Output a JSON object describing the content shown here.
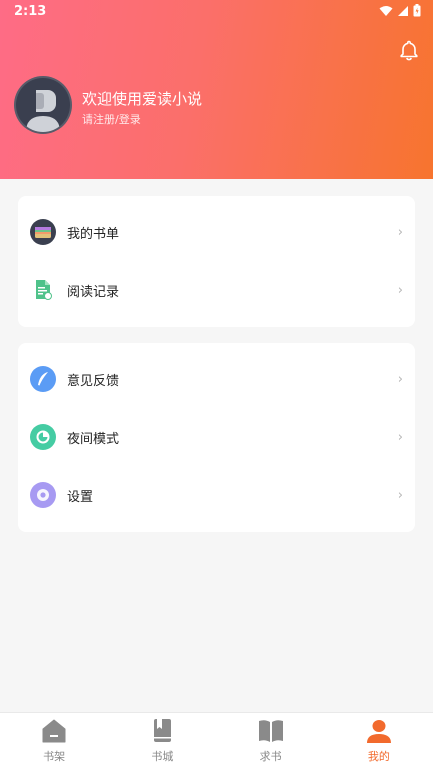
{
  "status": {
    "time": "2:13"
  },
  "profile": {
    "welcome": "欢迎使用爱读小说",
    "login": "请注册/登录"
  },
  "menu_group_1": [
    {
      "label": "我的书单",
      "icon": "booklist-icon"
    },
    {
      "label": "阅读记录",
      "icon": "reading-record-icon"
    }
  ],
  "menu_group_2": [
    {
      "label": "意见反馈",
      "icon": "feedback-icon"
    },
    {
      "label": "夜间模式",
      "icon": "night-mode-icon"
    },
    {
      "label": "设置",
      "icon": "settings-icon"
    }
  ],
  "arrow": "›",
  "tabs": [
    {
      "label": "书架",
      "icon": "bookshelf-icon"
    },
    {
      "label": "书城",
      "icon": "bookstore-icon"
    },
    {
      "label": "求书",
      "icon": "request-book-icon"
    },
    {
      "label": "我的",
      "icon": "profile-icon",
      "active": true
    }
  ],
  "colors": {
    "gradient_start": "#fe6c86",
    "gradient_end": "#f7742e",
    "accent": "#f26a2d",
    "tab_inactive": "#888888"
  }
}
